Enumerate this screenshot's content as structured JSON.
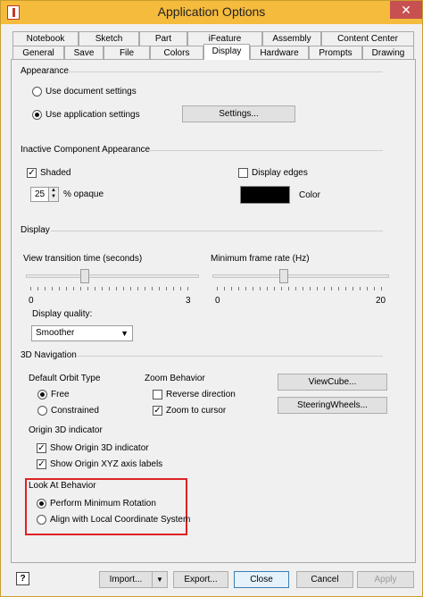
{
  "window": {
    "title": "Application Options",
    "close_glyph": "✕"
  },
  "tabs_row1": [
    "Notebook",
    "Sketch",
    "Part",
    "iFeature",
    "Assembly",
    "Content Center"
  ],
  "tabs_row2": [
    "General",
    "Save",
    "File",
    "Colors",
    "Display",
    "Hardware",
    "Prompts",
    "Drawing"
  ],
  "active_tab": "Display",
  "appearance": {
    "label": "Appearance",
    "use_document": "Use document settings",
    "use_application": "Use application settings",
    "selected": "use_application",
    "settings_button": "Settings..."
  },
  "inactive": {
    "label": "Inactive Component Appearance",
    "shaded": "Shaded",
    "shaded_checked": true,
    "display_edges": "Display edges",
    "display_edges_checked": false,
    "opacity_value": "25",
    "opacity_label": "% opaque",
    "color_label": "Color",
    "color_value": "#000000"
  },
  "display": {
    "label": "Display",
    "view_transition_label": "View transition time (seconds)",
    "view_transition_min": "0",
    "view_transition_max": "3",
    "view_transition_value": 0.3333,
    "min_frame_rate_label": "Minimum frame rate (Hz)",
    "min_frame_rate_min": "0",
    "min_frame_rate_max": "20",
    "min_frame_rate_value": 0.4,
    "quality_label": "Display quality:",
    "quality_value": "Smoother"
  },
  "nav3d": {
    "label": "3D Navigation",
    "orbit_label": "Default Orbit Type",
    "orbit_free": "Free",
    "orbit_constrained": "Constrained",
    "orbit_selected": "free",
    "zoom_label": "Zoom Behavior",
    "reverse_direction": "Reverse direction",
    "reverse_checked": false,
    "zoom_to_cursor": "Zoom to cursor",
    "zoom_to_cursor_checked": true,
    "viewcube_button": "ViewCube...",
    "steeringwheels_button": "SteeringWheels...",
    "origin_label": "Origin 3D indicator",
    "show_origin_indicator": "Show Origin 3D indicator",
    "show_origin_indicator_checked": true,
    "show_origin_labels": "Show Origin XYZ axis labels",
    "show_origin_labels_checked": true,
    "lookat_label": "Look At Behavior",
    "perform_min_rotation": "Perform Minimum Rotation",
    "align_local": "Align with Local Coordinate System",
    "lookat_selected": "min_rotation"
  },
  "footer": {
    "help_glyph": "?",
    "import": "Import...",
    "import_arrow": "▼",
    "export": "Export...",
    "close": "Close",
    "cancel": "Cancel",
    "apply": "Apply"
  },
  "glyphs": {
    "check": "✓",
    "spin_up": "▲",
    "spin_down": "▼",
    "dropdown_arrow": "▼"
  },
  "colors": {
    "title_bar": "#f5bb3c",
    "close_button": "#c75050",
    "highlight": "#dd2222"
  }
}
